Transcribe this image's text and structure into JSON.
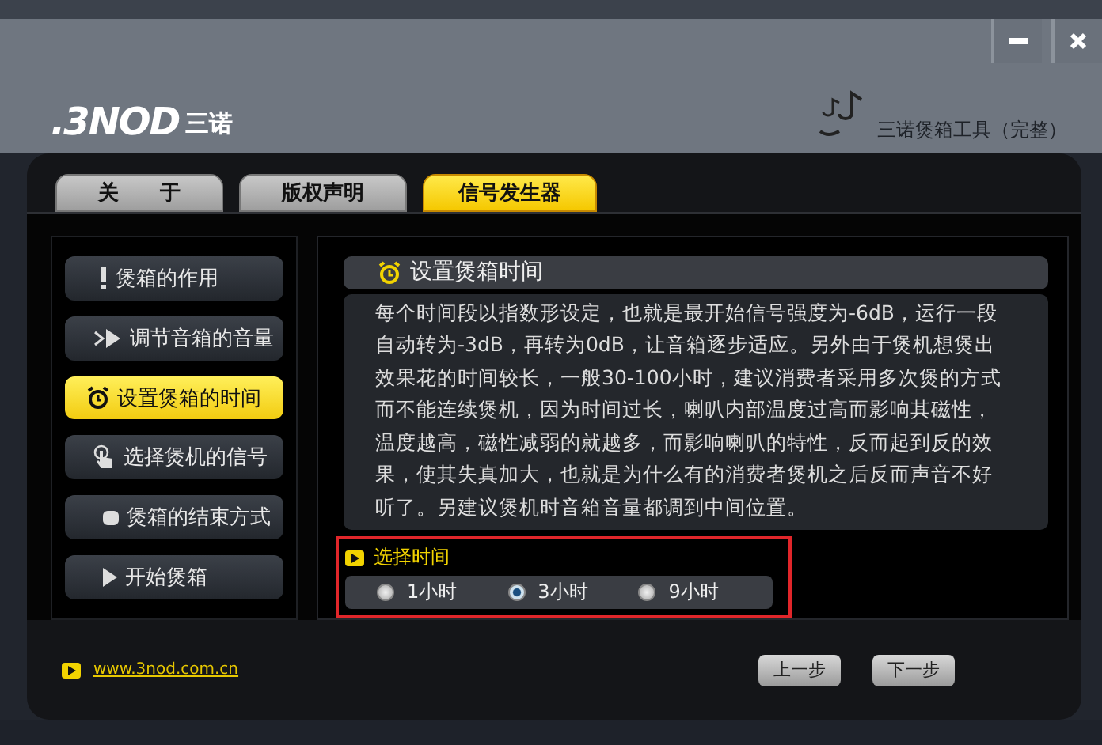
{
  "window": {
    "buttons": [
      {
        "kind": "minimize"
      },
      {
        "kind": "close"
      }
    ]
  },
  "logo": {
    "mark": ".3NOD",
    "name": "三诺"
  },
  "app_title": "三诺煲箱工具（完整）",
  "tabs": [
    {
      "label": "关　　于",
      "selected": false
    },
    {
      "label": "版权声明",
      "selected": false
    },
    {
      "label": "信号发生器",
      "selected": true
    }
  ],
  "sidebar": {
    "items": [
      {
        "label": "煲箱的作用",
        "kind": "exclamation",
        "selected": false
      },
      {
        "label": "调节音箱的音量",
        "kind": "volume",
        "selected": false
      },
      {
        "label": "设置煲箱的时间",
        "kind": "clock",
        "selected": true
      },
      {
        "label": "选择煲机的信号",
        "kind": "touch",
        "selected": false
      },
      {
        "label": "煲箱的结束方式",
        "kind": "stop",
        "selected": false
      },
      {
        "label": "开始煲箱",
        "kind": "play",
        "selected": false
      }
    ]
  },
  "content": {
    "title": "设置煲箱时间",
    "body": "每个时间段以指数形设定，也就是最开始信号强度为-6dB，运行一段自动转为-3dB，再转为0dB，让音箱逐步适应。另外由于煲机想煲出效果花的时间较长，一般30-100小时，建议消费者采用多次煲的方式而不能连续煲机，因为时间过长，喇叭内部温度过高而影响其磁性，温度越高，磁性减弱的就越多，而影响喇叭的特性，反而起到反的效果，使其失真加大，也就是为什么有的消费者煲机之后反而声音不好听了。另建议煲机时音箱音量都调到中间位置。",
    "choice_label": "选择时间",
    "options": [
      {
        "label": "1小时",
        "selected": false
      },
      {
        "label": "3小时",
        "selected": true
      },
      {
        "label": "9小时",
        "selected": false
      }
    ]
  },
  "footer": {
    "link": "www.3nod.com.cn",
    "buttons": [
      "上一步",
      "下一步"
    ]
  }
}
